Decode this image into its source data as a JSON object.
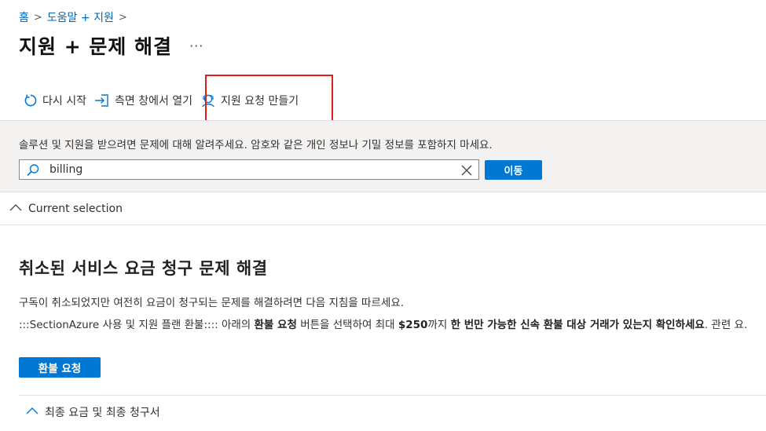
{
  "breadcrumb": {
    "items": [
      "홈",
      "도움말 + 지원"
    ],
    "separator": ">"
  },
  "page": {
    "title": "지원 + 문제 해결",
    "more_label": "···"
  },
  "toolbar": {
    "restart_label": "다시 시작",
    "open_side_label": "측면 창에서 열기",
    "create_request_label": "지원 요청 만들기"
  },
  "search": {
    "hint": "솔루션 및 지원을 받으려면 문제에 대해 알려주세요. 암호와 같은 개인 정보나 기밀 정보를 포함하지 마세요.",
    "value": "billing",
    "go_label": "이동"
  },
  "current_selection": {
    "label": "Current selection"
  },
  "solution": {
    "title": "취소된 서비스 요금 청구 문제 해결",
    "description": "구독이 취소되었지만 여전히 요금이 청구되는 문제를 해결하려면 다음 지침을 따르세요.",
    "section_prefix": ":::SectionAzure 사용 및 지원 플랜 환불:::: 아래의 ",
    "section_bold1": "환불 요청",
    "section_mid1": " 버튼을 선택하여 최대 ",
    "section_bold2": "$250",
    "section_mid2": "까지 ",
    "section_bold3": "한 번만 가능한 신속 환불 대상 거래가 있는지 확인하세요",
    "section_suffix": ". 관련 요.",
    "refund_button_label": "환불 요청"
  },
  "final_bill": {
    "label": "최종 요금 및 최종 청구서"
  },
  "colors": {
    "accent": "#0078d4",
    "link": "#0067b8",
    "highlight": "#e21d1d",
    "panel_bg": "#f3f2f1"
  },
  "icons": [
    "restart-icon",
    "open-side-pane-icon",
    "support-person-icon",
    "search-icon",
    "close-icon",
    "chevron-up-icon"
  ]
}
